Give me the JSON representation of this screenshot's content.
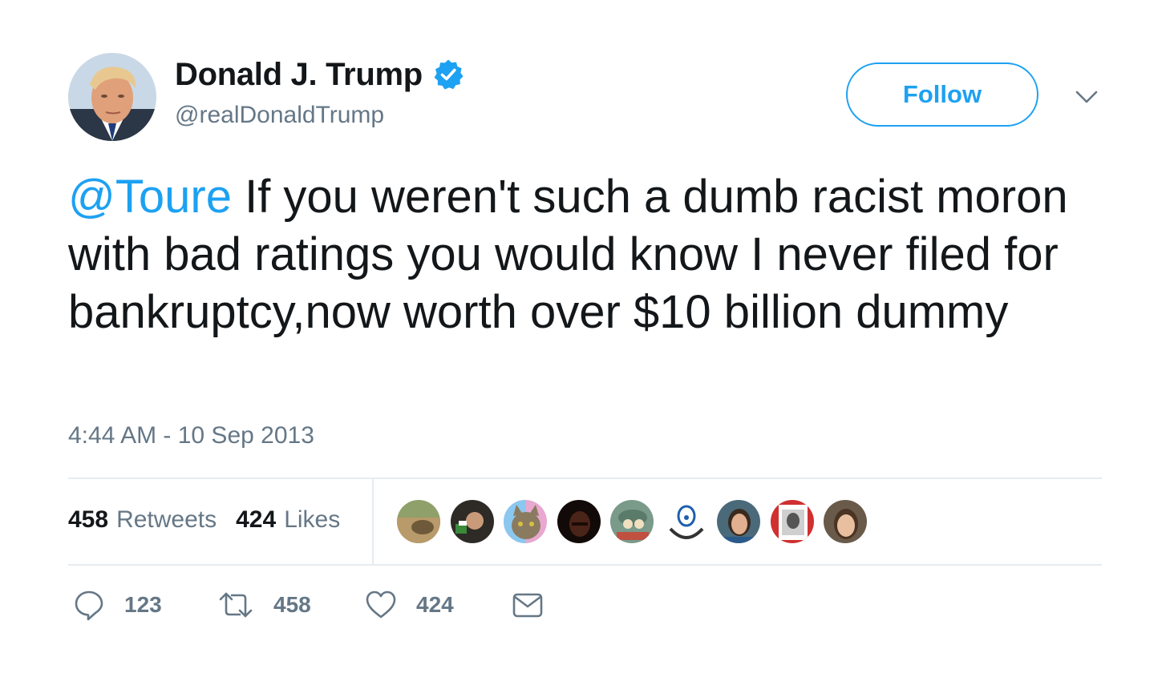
{
  "author": {
    "display_name": "Donald J. Trump",
    "handle": "@realDonaldTrump",
    "verified": true
  },
  "follow_label": "Follow",
  "tweet": {
    "mention": "@Toure",
    "text": " If you weren't such a dumb racist moron with bad ratings you would know I never filed for bankruptcy,now worth over $10 billion dummy"
  },
  "timestamp": "4:44 AM - 10 Sep 2013",
  "stats": {
    "retweets_count": "458",
    "retweets_label": "Retweets",
    "likes_count": "424",
    "likes_label": "Likes"
  },
  "liker_avatar_count": 9,
  "actions": {
    "replies": "123",
    "retweets": "458",
    "likes": "424"
  },
  "colors": {
    "accent": "#1da1f2",
    "text": "#14171a",
    "secondary": "#657786",
    "divider": "#e6ecf0"
  },
  "icons": {
    "verified": "verified-badge-icon",
    "caret": "chevron-down-icon",
    "reply": "reply-icon",
    "retweet": "retweet-icon",
    "like": "heart-icon",
    "dm": "envelope-icon"
  }
}
